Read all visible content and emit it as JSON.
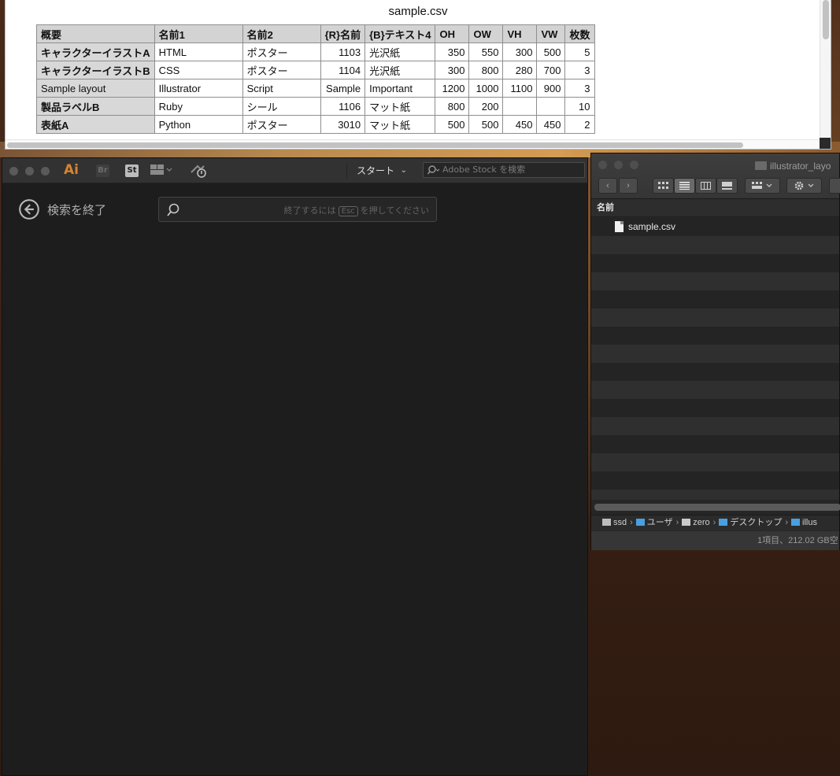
{
  "preview": {
    "title": "sample.csv",
    "columns": [
      "概要",
      "名前1",
      "名前2",
      "{R}名前",
      "{B}テキスト4",
      "OH",
      "OW",
      "VH",
      "VW",
      "枚数"
    ],
    "rows": [
      [
        "キャラクターイラストA",
        "HTML",
        "ポスター",
        "1103",
        "光沢紙",
        "350",
        "550",
        "300",
        "500",
        "5"
      ],
      [
        "キャラクターイラストB",
        "CSS",
        "ポスター",
        "1104",
        "光沢紙",
        "300",
        "800",
        "280",
        "700",
        "3"
      ],
      [
        "Sample layout",
        "Illustrator",
        "Script",
        "Sample",
        "Important",
        "1200",
        "1000",
        "1100",
        "900",
        "3"
      ],
      [
        "製品ラベルB",
        "Ruby",
        "シール",
        "1106",
        "マット紙",
        "800",
        "200",
        "",
        "",
        "10"
      ],
      [
        "表紙A",
        "Python",
        "ポスター",
        "3010",
        "マット紙",
        "500",
        "500",
        "450",
        "450",
        "2"
      ]
    ]
  },
  "illustrator": {
    "logo": "Ai",
    "bridge_chip": "Br",
    "stock_chip": "St",
    "workspace_label": "スタート",
    "stock_search_placeholder": "Adobe Stock を検索",
    "exit_search_label": "検索を終了",
    "search_hint_before": "終了するには",
    "search_hint_key": "Esc",
    "search_hint_after": "を押してください",
    "icons": [
      "layout-icon",
      "sync-icon",
      "search-icon",
      "back-arrow-icon"
    ]
  },
  "finder": {
    "title": "illustrator_layo",
    "column_header": "名前",
    "files": [
      {
        "name": "sample.csv",
        "icon": "document-icon"
      }
    ],
    "path": [
      "ssd",
      "ユーザ",
      "zero",
      "デスクトップ",
      "illus"
    ],
    "status": "1項目、212.02 GB空"
  }
}
